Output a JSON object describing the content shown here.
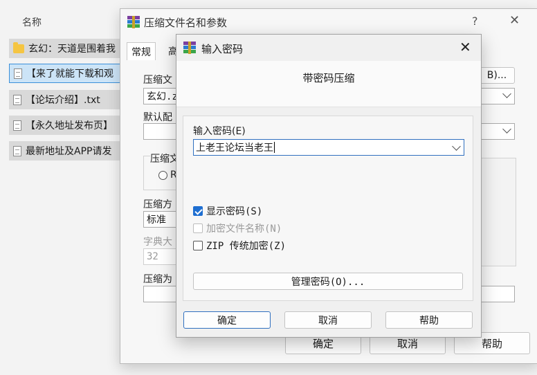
{
  "explorer": {
    "column_header": "名称",
    "files": [
      {
        "name": "玄幻：天道是围着我",
        "type": "folder",
        "selected": false
      },
      {
        "name": "【来了就能下载和观",
        "type": "doc",
        "selected": true
      },
      {
        "name": "【论坛介绍】.txt",
        "type": "doc",
        "selected": false
      },
      {
        "name": "【永久地址发布页】",
        "type": "doc",
        "selected": false
      },
      {
        "name": "最新地址及APP请发",
        "type": "doc",
        "selected": false
      }
    ]
  },
  "back_dialog": {
    "title": "压缩文件名和参数",
    "help_icon": "?",
    "close_icon": "✕",
    "tabs": [
      "常规",
      "高"
    ],
    "archive_name_label": "压缩文",
    "browse_button": "B)...",
    "archive_name_value": "玄幻.z",
    "default_profile_label": "默认配",
    "format_label": "压缩文",
    "format_option": "R",
    "method_label": "压缩方",
    "method_value": "标准",
    "dict_label": "字典大",
    "dict_value": "32",
    "split_label": "压缩为",
    "ok_button": "确定",
    "cancel_button": "取消",
    "help_button": "帮助"
  },
  "front_dialog": {
    "title": "输入密码",
    "close_icon": "✕",
    "header": "带密码压缩",
    "password_label": "输入密码(E)",
    "password_value": "上老王论坛当老王",
    "show_password": {
      "label": "显示密码(S)",
      "checked": true
    },
    "encrypt_names": {
      "label": "加密文件名称(N)",
      "checked": false,
      "disabled": true
    },
    "zip_legacy": {
      "label": "ZIP 传统加密(Z)",
      "checked": false
    },
    "manage_button": "管理密码(O)...",
    "ok_button": "确定",
    "cancel_button": "取消",
    "help_button": "帮助"
  }
}
